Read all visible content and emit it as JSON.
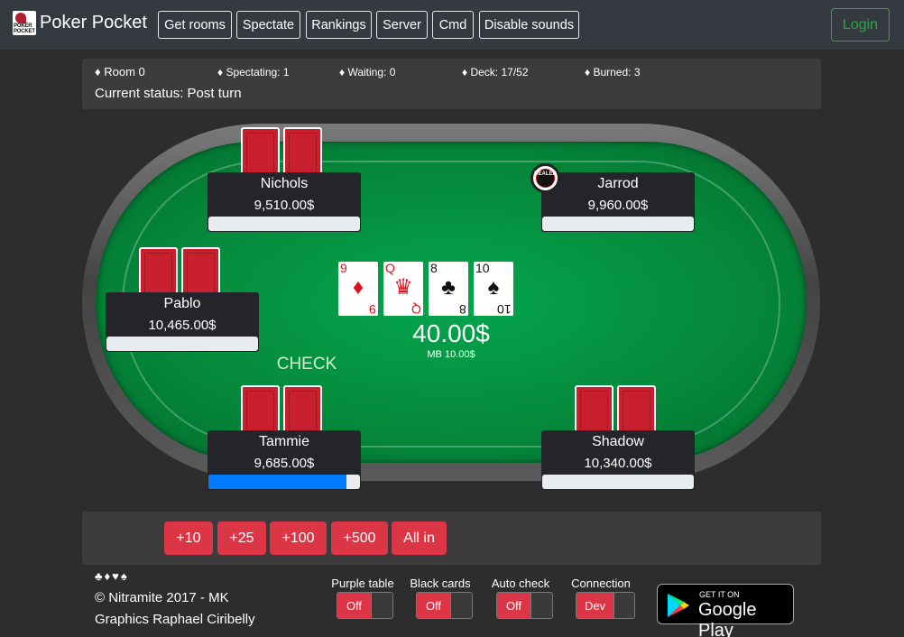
{
  "nav": {
    "brand": "Poker Pocket",
    "logo_text": "POKER POCKET",
    "buttons": [
      "Get rooms",
      "Spectate",
      "Rankings",
      "Server",
      "Cmd",
      "Disable sounds"
    ],
    "login": "Login"
  },
  "info": {
    "room": "♦ Room 0",
    "spectating": "♦ Spectating: 1",
    "waiting": "♦ Waiting: 0",
    "deck": "♦ Deck: 17/52",
    "burned": "♦ Burned: 3",
    "status": "Current status: Post turn"
  },
  "players": [
    {
      "name": "Nichols",
      "stack": "9,510.00$",
      "progress": 0
    },
    {
      "name": "Jarrod",
      "stack": "9,960.00$",
      "progress": 0
    },
    {
      "name": "Pablo",
      "stack": "10,465.00$",
      "progress": 0
    },
    {
      "name": "Tammie",
      "stack": "9,685.00$",
      "progress": 0.91
    },
    {
      "name": "Shadow",
      "stack": "10,340.00$",
      "progress": 0
    }
  ],
  "dealer_chip": "DEALER",
  "community_cards": [
    {
      "rank": "9",
      "suit": "♦",
      "color": "red"
    },
    {
      "rank": "Q",
      "suit": "♛",
      "color": "red"
    },
    {
      "rank": "8",
      "suit": "♣",
      "color": "black"
    },
    {
      "rank": "10",
      "suit": "♠",
      "color": "black"
    }
  ],
  "pot": {
    "amount": "40.00$",
    "sub": "MB 10.00$"
  },
  "last_action": "CHECK",
  "bet_buttons": [
    "+10",
    "+25",
    "+100",
    "+500",
    "All in"
  ],
  "footer": {
    "suits": "♣♦♥♠",
    "copyright": "© Nitramite 2017 - MK",
    "credits": "Graphics Raphael Ciribelly",
    "toggles": [
      {
        "label": "Purple table",
        "value": "Off"
      },
      {
        "label": "Black cards",
        "value": "Off"
      },
      {
        "label": "Auto check",
        "value": "Off"
      },
      {
        "label": "Connection",
        "value": "Dev"
      }
    ],
    "store_small": "GET IT ON",
    "store_big": "Google Play"
  },
  "colors": {
    "accent": "#dc3545",
    "felt": "#058a3c",
    "login": "#28a745",
    "progress": "#007bff"
  }
}
